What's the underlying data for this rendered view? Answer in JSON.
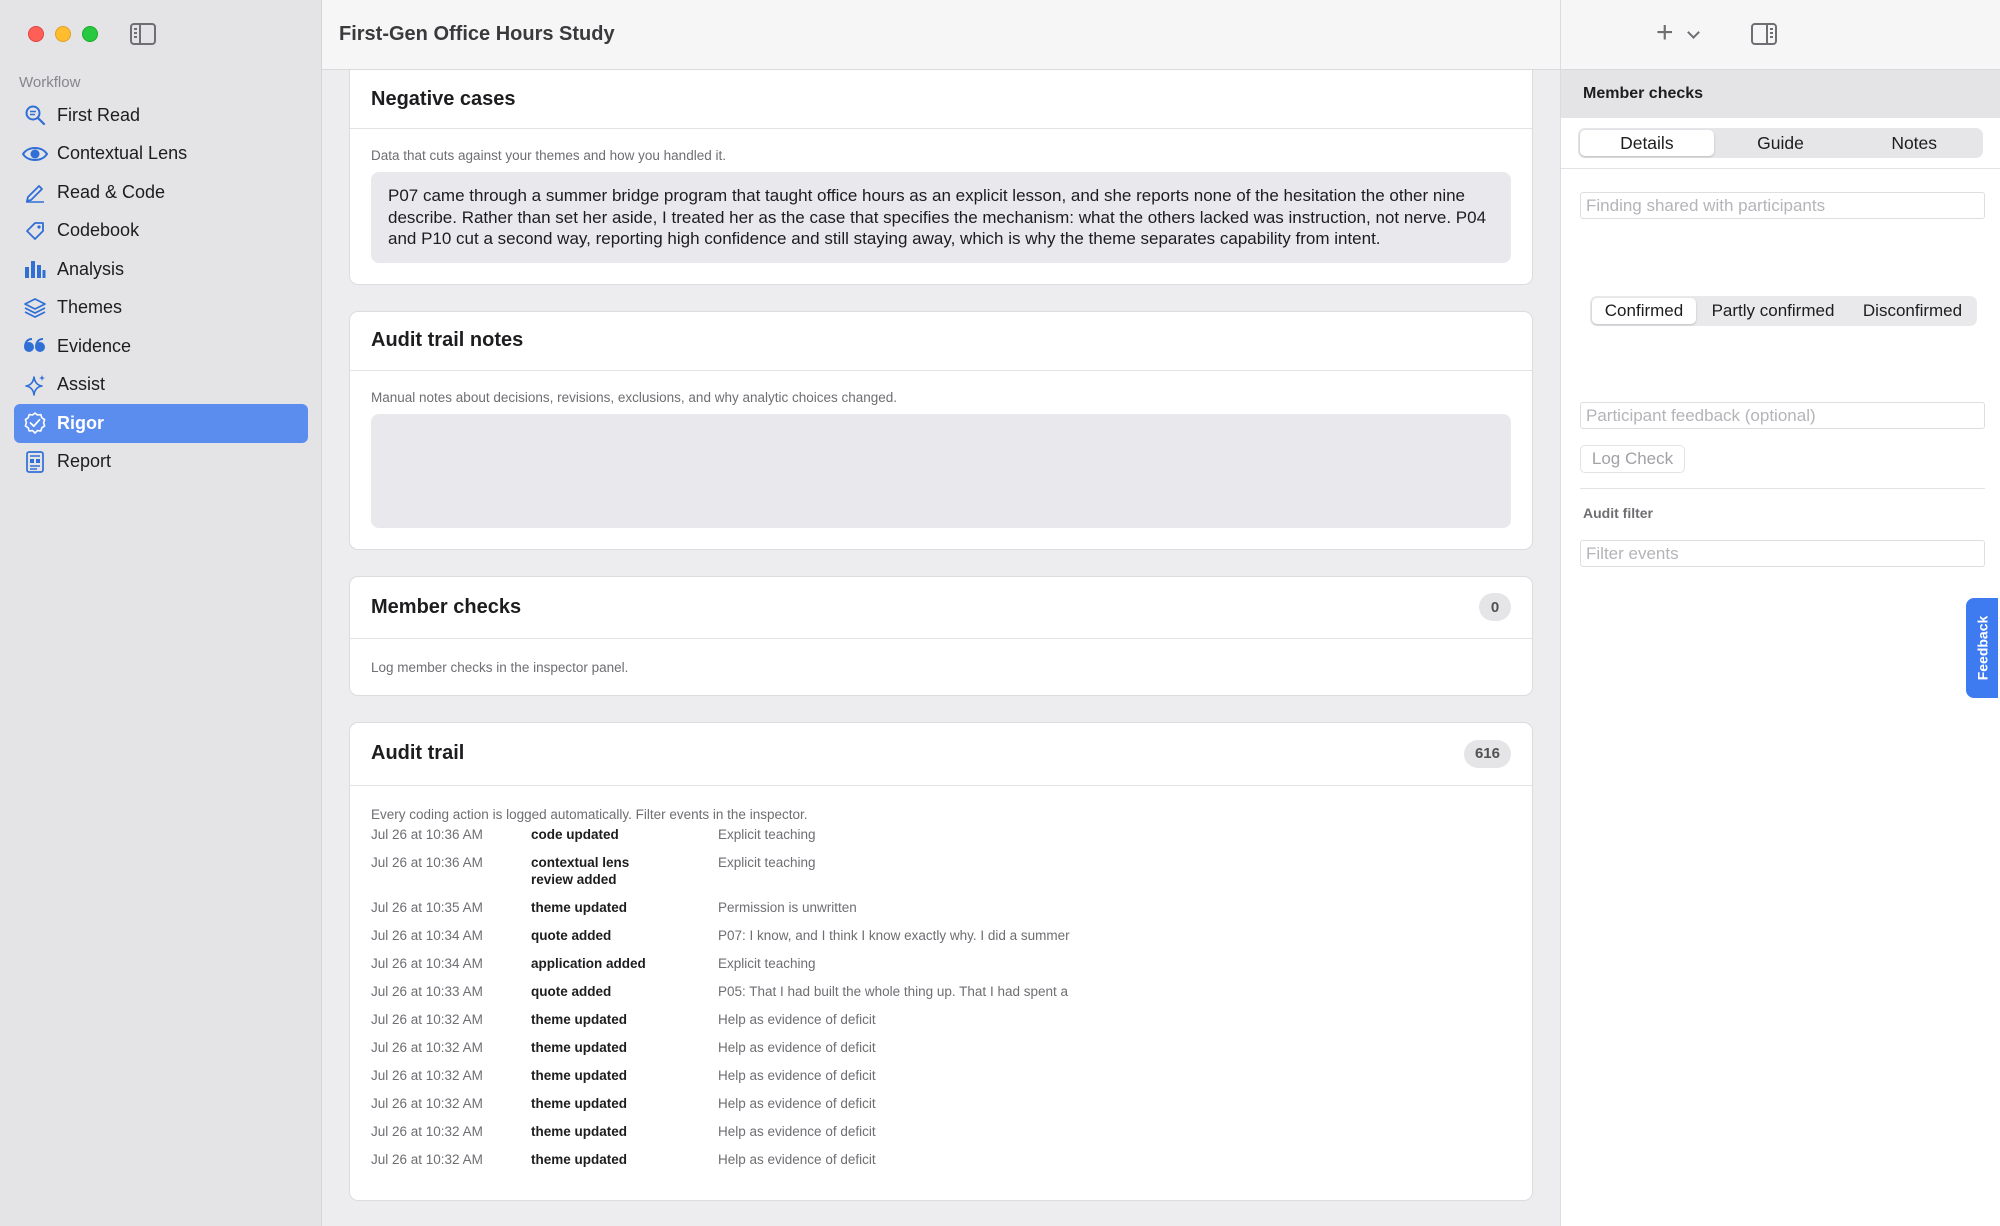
{
  "window": {
    "title": "First-Gen Office Hours Study"
  },
  "sidebar": {
    "section_label": "Workflow",
    "items": [
      {
        "label": "First Read",
        "icon": "magnifier-doc-icon"
      },
      {
        "label": "Contextual Lens",
        "icon": "eye-icon"
      },
      {
        "label": "Read & Code",
        "icon": "pencil-icon"
      },
      {
        "label": "Codebook",
        "icon": "tag-icon"
      },
      {
        "label": "Analysis",
        "icon": "bar-chart-icon"
      },
      {
        "label": "Themes",
        "icon": "layers-icon"
      },
      {
        "label": "Evidence",
        "icon": "quote-icon"
      },
      {
        "label": "Assist",
        "icon": "sparkle-icon"
      },
      {
        "label": "Rigor",
        "icon": "checkmark-seal-icon",
        "active": true
      },
      {
        "label": "Report",
        "icon": "report-icon"
      }
    ]
  },
  "cards": {
    "negative_cases": {
      "title": "Negative cases",
      "helper": "Data that cuts against your themes and how you handled it.",
      "text": "P07 came through a summer bridge program that taught office hours as an explicit lesson, and she reports none of the hesitation the other nine describe. Rather than set her aside, I treated her as the case that specifies the mechanism: what the others lacked was instruction, not nerve. P04 and P10 cut a second way, reporting high confidence and still staying away, which is why the theme separates capability from intent."
    },
    "audit_notes": {
      "title": "Audit trail notes",
      "helper": "Manual notes about decisions, revisions, exclusions, and why analytic choices changed.",
      "text": ""
    },
    "member_checks": {
      "title": "Member checks",
      "count": "0",
      "helper": "Log member checks in the inspector panel."
    },
    "audit_trail": {
      "title": "Audit trail",
      "count": "616",
      "helper": "Every coding action is logged automatically. Filter events in the inspector.",
      "rows": [
        {
          "date": "Jul 26 at 10:36 AM",
          "action": "code updated",
          "detail": "Explicit teaching"
        },
        {
          "date": "Jul 26 at 10:36 AM",
          "action": "contextual lens review added",
          "detail": "Explicit teaching"
        },
        {
          "date": "Jul 26 at 10:35 AM",
          "action": "theme updated",
          "detail": "Permission is unwritten"
        },
        {
          "date": "Jul 26 at 10:34 AM",
          "action": "quote added",
          "detail": "P07: I know, and I think I know exactly why. I did a summer"
        },
        {
          "date": "Jul 26 at 10:34 AM",
          "action": "application added",
          "detail": "Explicit teaching"
        },
        {
          "date": "Jul 26 at 10:33 AM",
          "action": "quote added",
          "detail": "P05: That I had built the whole thing up. That I had spent a"
        },
        {
          "date": "Jul 26 at 10:32 AM",
          "action": "theme updated",
          "detail": "Help as evidence of deficit"
        },
        {
          "date": "Jul 26 at 10:32 AM",
          "action": "theme updated",
          "detail": "Help as evidence of deficit"
        },
        {
          "date": "Jul 26 at 10:32 AM",
          "action": "theme updated",
          "detail": "Help as evidence of deficit"
        },
        {
          "date": "Jul 26 at 10:32 AM",
          "action": "theme updated",
          "detail": "Help as evidence of deficit"
        },
        {
          "date": "Jul 26 at 10:32 AM",
          "action": "theme updated",
          "detail": "Help as evidence of deficit"
        },
        {
          "date": "Jul 26 at 10:32 AM",
          "action": "theme updated",
          "detail": "Help as evidence of deficit"
        }
      ]
    }
  },
  "inspector": {
    "header": "Member checks",
    "tabs": [
      "Details",
      "Guide",
      "Notes"
    ],
    "selected_tab": "Details",
    "finding_placeholder": "Finding shared with participants",
    "outcomes": [
      "Confirmed",
      "Partly confirmed",
      "Disconfirmed"
    ],
    "selected_outcome": "Confirmed",
    "feedback_placeholder": "Participant feedback (optional)",
    "log_button": "Log Check",
    "audit_filter_label": "Audit filter",
    "filter_placeholder": "Filter events",
    "feedback_tab": "Feedback"
  },
  "colors": {
    "accent": "#5b8def",
    "icon_blue": "#2f6fd6",
    "feedback": "#3e7bf0"
  }
}
